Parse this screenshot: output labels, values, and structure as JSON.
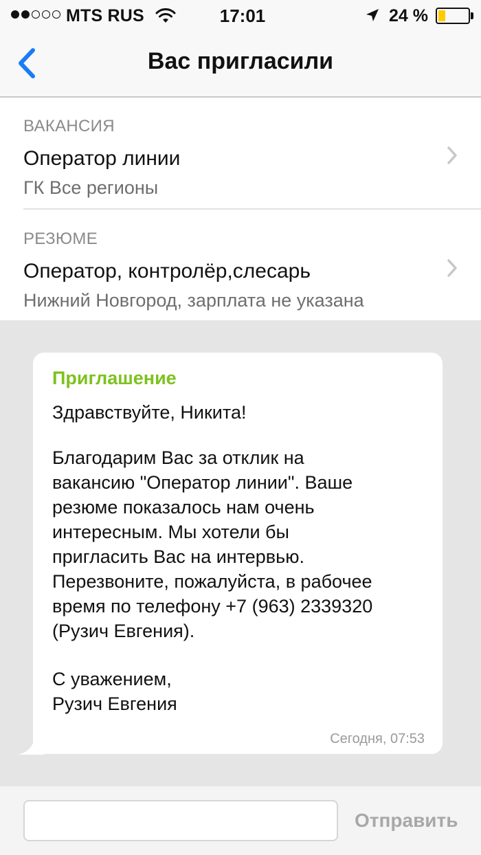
{
  "status_bar": {
    "carrier": "MTS RUS",
    "time": "17:01",
    "battery_percent": "24 %",
    "battery_level": 0.24,
    "signal_bars_filled": 2,
    "signal_bars_total": 5,
    "icons": [
      "signal-dots",
      "wifi-icon",
      "location-arrow-icon",
      "battery-icon"
    ],
    "battery_color": "#ffcc00"
  },
  "nav": {
    "back_icon": "chevron-left-icon",
    "title": "Вас пригласили",
    "accent_color": "#1a7cf5"
  },
  "vacancy": {
    "label": "ВАКАНСИЯ",
    "title": "Оператор линии",
    "subtitle": "ГК Все регионы"
  },
  "resume": {
    "label": "РЕЗЮМЕ",
    "title": "Оператор, контролёр,слесарь",
    "subtitle": "Нижний Новгород, зарплата не указана"
  },
  "message": {
    "heading": "Приглашение",
    "heading_color": "#7dc21e",
    "lines": [
      "Здравствуйте, Никита!",
      "Благодарим Вас за отклик на",
      "вакансию \"Оператор линии\". Ваше",
      "резюме показалось нам очень",
      "интересным. Мы хотели бы",
      "пригласить Вас на интервью.",
      "Перезвоните, пожалуйста, в рабочее",
      "время по телефону +7 (963) 2339320",
      "(Рузич Евгения).",
      "С уважением,",
      "Рузич Евгения"
    ],
    "timestamp": "Сегодня, 07:53"
  },
  "input": {
    "value": "",
    "placeholder": "",
    "send_label": "Отправить"
  }
}
